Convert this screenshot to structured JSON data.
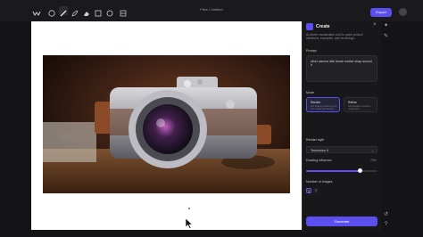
{
  "app": {
    "title": "Files / Untitled",
    "export_label": "Export"
  },
  "toolbar": {
    "tools": [
      "logo-icon",
      "select-circle-icon",
      "brush-icon",
      "pen-icon",
      "eraser-icon",
      "shape-icon",
      "text-icon",
      "frame-icon"
    ]
  },
  "panel": {
    "title": "Create",
    "close_label": "×",
    "description": "AI-driven visualization tool for quick product variations, examples, and renderings.",
    "prompt_label": "Prompt",
    "prompt_text": "silver camera with brown leather strap around it",
    "mode_label": "Mode",
    "modes": [
      {
        "title": "Render",
        "subtitle": "Get striking renderings of your ideas and designs",
        "selected": true
      },
      {
        "title": "Refine",
        "subtitle": "Add details to refine a rough idea",
        "selected": false
      }
    ],
    "render_style_label": "Render style",
    "render_style_value": "Technicolor 6",
    "drawing_influence_label": "Drawing influence",
    "drawing_influence_value": "75%",
    "drawing_influence_fraction": 0.75,
    "num_images_label": "Number of images",
    "num_images_options": [
      "1",
      "2"
    ],
    "num_images_selected": "1",
    "generate_label": "Generate"
  },
  "colors": {
    "accent": "#5b4ff0",
    "background": "#141416",
    "panel": "#18181b",
    "canvas": "#ffffff"
  }
}
